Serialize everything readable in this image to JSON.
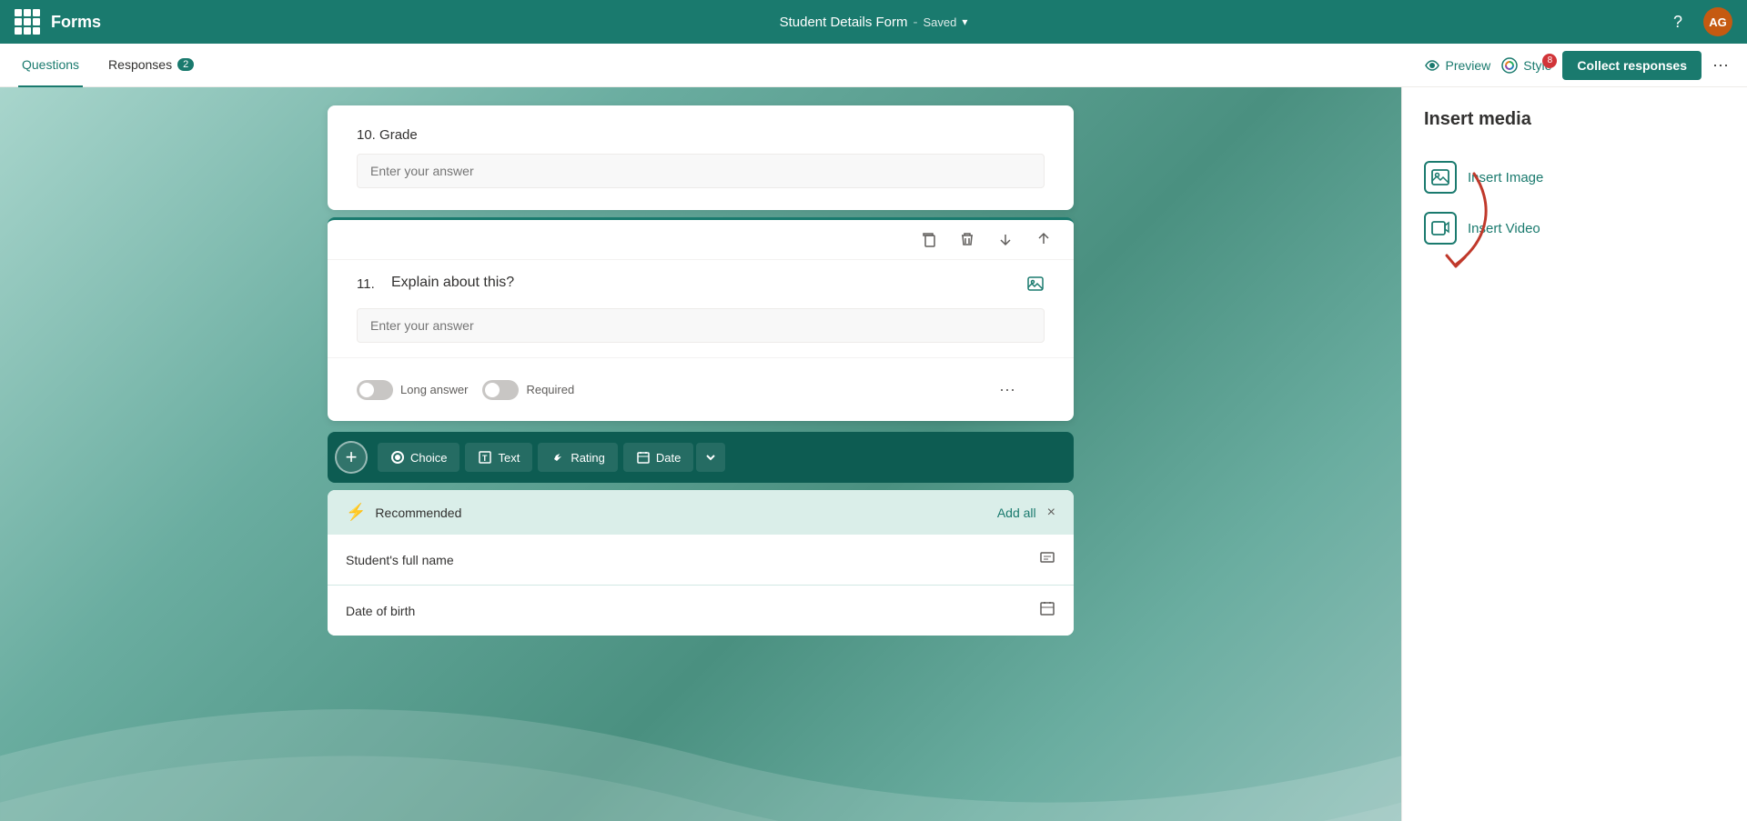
{
  "app": {
    "title": "Forms",
    "waffle_label": "App launcher"
  },
  "header": {
    "form_title": "Student Details Form",
    "saved_label": "Saved",
    "help_label": "?",
    "avatar_initials": "AG"
  },
  "subnav": {
    "tabs": [
      {
        "id": "questions",
        "label": "Questions",
        "active": true,
        "badge": null
      },
      {
        "id": "responses",
        "label": "Responses",
        "active": false,
        "badge": "2"
      }
    ],
    "preview_label": "Preview",
    "style_label": "Style",
    "collect_label": "Collect responses",
    "more_label": "..."
  },
  "questions": [
    {
      "id": "q10",
      "number": "10.",
      "text": "Grade",
      "answer_placeholder": "Enter your answer",
      "active": false
    },
    {
      "id": "q11",
      "number": "11.",
      "text": "Explain about this?",
      "answer_placeholder": "Enter your answer",
      "active": true,
      "long_answer_label": "Long answer",
      "required_label": "Required"
    }
  ],
  "add_bar": {
    "add_btn_label": "+",
    "types": [
      {
        "id": "choice",
        "label": "Choice",
        "icon": "◎"
      },
      {
        "id": "text",
        "label": "Text",
        "icon": "T"
      },
      {
        "id": "rating",
        "label": "Rating",
        "icon": "👍"
      },
      {
        "id": "date",
        "label": "Date",
        "icon": "📅"
      }
    ],
    "expand_label": "▾"
  },
  "recommended": {
    "title": "Recommended",
    "lightning_icon": "⚡",
    "add_all_label": "Add all",
    "close_label": "×",
    "items": [
      {
        "id": "full-name",
        "text": "Student's full name",
        "icon": "T"
      },
      {
        "id": "dob",
        "text": "Date of birth",
        "icon": "📅"
      }
    ]
  },
  "right_panel": {
    "title": "Insert media",
    "insert_image_label": "Insert Image",
    "insert_video_label": "Insert Video",
    "image_icon": "🖼",
    "video_icon": "🎬"
  },
  "colors": {
    "primary": "#1a7a6e",
    "dark_primary": "#0d5c52",
    "accent": "#c55a11"
  }
}
